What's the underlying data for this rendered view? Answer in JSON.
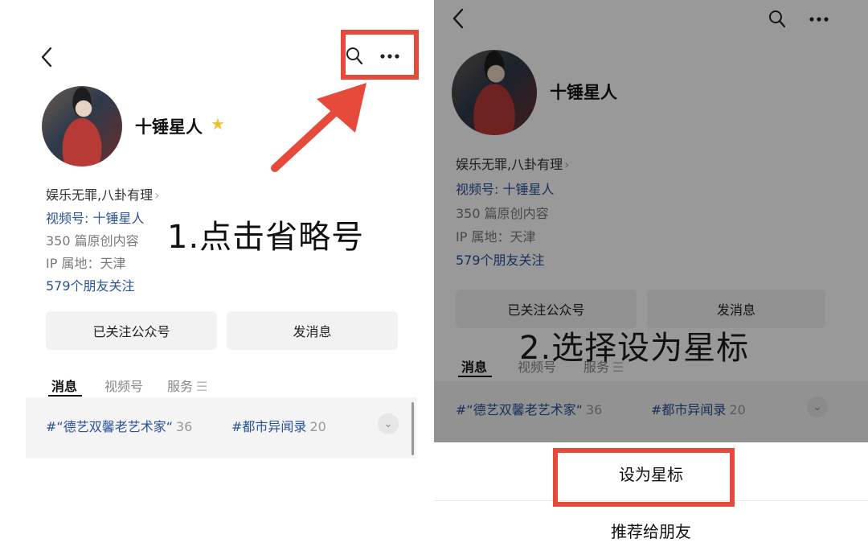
{
  "left": {
    "profile": {
      "name": "十锤星人",
      "bio": "娱乐无罪,八卦有理",
      "channel_link": "视频号: 十锤星人",
      "articles": "350 篇原创内容",
      "ip_location": "IP 属地：天津",
      "friends_following": "579个朋友关注"
    },
    "actions": {
      "follow_button": "已关注公众号",
      "message_button": "发消息"
    },
    "tabs": [
      "消息",
      "视频号",
      "服务"
    ],
    "tags": [
      {
        "label": "#“德艺双馨老艺术家“",
        "count": "36"
      },
      {
        "label": "#都市异闻录",
        "count": "20"
      }
    ],
    "instruction": "1.点击省略号"
  },
  "right": {
    "profile": {
      "name": "十锤星人",
      "bio": "娱乐无罪,八卦有理",
      "channel_link": "视频号: 十锤星人",
      "articles": "350 篇原创内容",
      "ip_location": "IP 属地：天津",
      "friends_following": "579个朋友关注"
    },
    "actions": {
      "follow_button": "已关注公众号",
      "message_button": "发消息"
    },
    "tabs": [
      "消息",
      "视频号",
      "服务"
    ],
    "tags": [
      {
        "label": "#“德艺双馨老艺术家“",
        "count": "36"
      },
      {
        "label": "#都市异闻录",
        "count": "20"
      }
    ],
    "instruction": "2.选择设为星标",
    "sheet": {
      "set_star": "设为星标",
      "recommend": "推荐给朋友"
    }
  },
  "colors": {
    "highlight": "#e64a3b",
    "link_blue": "#2a5294",
    "star": "#f1c232"
  }
}
